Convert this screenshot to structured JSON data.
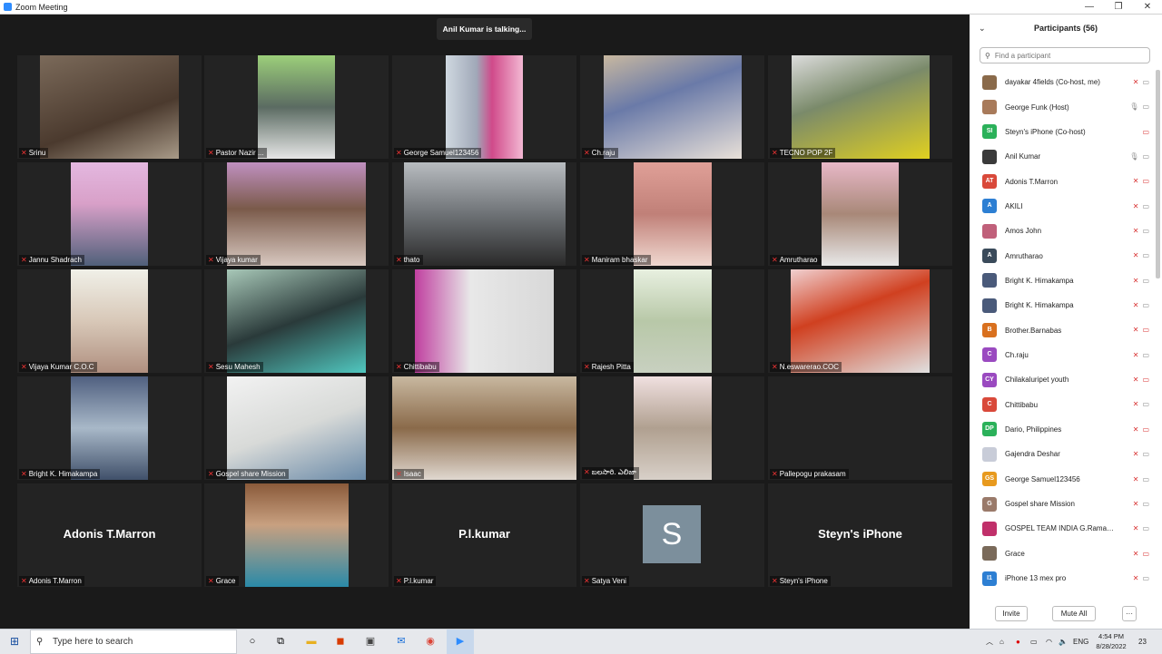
{
  "window": {
    "title": "Zoom Meeting",
    "controls": [
      "—",
      "❐",
      "✕"
    ]
  },
  "meeting": {
    "speaker_banner": "Anil Kumar is talking...",
    "tiles": [
      {
        "label": "Srinu",
        "video": "v1"
      },
      {
        "label": "Pastor Nazir ...",
        "video": "v2"
      },
      {
        "label": "George Samuel123456",
        "video": "v3"
      },
      {
        "label": "Ch.raju",
        "video": "v4"
      },
      {
        "label": "TECNO POP 2F",
        "video": "v5"
      },
      {
        "label": "Jannu Shadrach",
        "video": "v6"
      },
      {
        "label": "Vijaya kumar",
        "video": "v7"
      },
      {
        "label": "thato",
        "video": "v8"
      },
      {
        "label": "Maniram bhaskar",
        "video": "v9"
      },
      {
        "label": "Amrutharao",
        "video": "v10"
      },
      {
        "label": "Vijaya Kumar C.O.C",
        "video": "v11"
      },
      {
        "label": "Sesu Mahesh",
        "video": "v12"
      },
      {
        "label": "Chittibabu",
        "video": "v13"
      },
      {
        "label": "Rajesh Pitta",
        "video": "v14"
      },
      {
        "label": "N.eswarerao.COC",
        "video": "v15"
      },
      {
        "label": "Bright K. Himakampa",
        "video": "v16"
      },
      {
        "label": "Gospel share Mission",
        "video": "v17"
      },
      {
        "label": "Isaac",
        "video": "v18"
      },
      {
        "label": "బలసారి. ఎలిజా",
        "video": "v19"
      },
      {
        "label": "Pallepogu prakasam",
        "video": ""
      },
      {
        "label": "Adonis T.Marron",
        "big_name": "Adonis T.Marron"
      },
      {
        "label": "Grace",
        "video": "v20"
      },
      {
        "label": "P.l.kumar",
        "big_name": "P.l.kumar"
      },
      {
        "label": "Satya Veni",
        "avatar_letter": "S"
      },
      {
        "label": "Steyn's iPhone",
        "big_name": "Steyn's iPhone"
      }
    ]
  },
  "participants_panel": {
    "title": "Participants (56)",
    "search_placeholder": "Find a participant",
    "participants": [
      {
        "name": "dayakar 4fields (Co-host, me)",
        "initials": "",
        "color": "#8a6a4a",
        "mic": "muted",
        "cam": "on"
      },
      {
        "name": "George Funk (Host)",
        "initials": "",
        "color": "#a87a5a",
        "mic": "on",
        "cam": "on"
      },
      {
        "name": "Steyn's iPhone (Co-host)",
        "initials": "SI",
        "color": "#2bb15a",
        "mic": "none",
        "cam": "off"
      },
      {
        "name": "Anil Kumar",
        "initials": "",
        "color": "#3a3a3a",
        "mic": "on",
        "cam": "on"
      },
      {
        "name": "Adonis T.Marron",
        "initials": "AT",
        "color": "#d9493a",
        "mic": "muted",
        "cam": "off"
      },
      {
        "name": "AKILI",
        "initials": "A",
        "color": "#2d7fd3",
        "mic": "muted",
        "cam": "on"
      },
      {
        "name": "Amos John",
        "initials": "",
        "color": "#c0607a",
        "mic": "muted",
        "cam": "on"
      },
      {
        "name": "Amrutharao",
        "initials": "A",
        "color": "#3a4a5a",
        "mic": "muted",
        "cam": "on"
      },
      {
        "name": "Bright K. Himakampa",
        "initials": "",
        "color": "#4a5a7a",
        "mic": "muted",
        "cam": "on"
      },
      {
        "name": "Bright K. Himakampa",
        "initials": "",
        "color": "#4a5a7a",
        "mic": "muted",
        "cam": "on"
      },
      {
        "name": "Brother.Barnabas",
        "initials": "B",
        "color": "#d9701e",
        "mic": "muted",
        "cam": "off"
      },
      {
        "name": "Ch.raju",
        "initials": "C",
        "color": "#9a4ac0",
        "mic": "muted",
        "cam": "on"
      },
      {
        "name": "Chilakaluripet youth",
        "initials": "CY",
        "color": "#9a4ac0",
        "mic": "muted",
        "cam": "off"
      },
      {
        "name": "Chittibabu",
        "initials": "C",
        "color": "#d9493a",
        "mic": "muted",
        "cam": "on"
      },
      {
        "name": "Dario, Philippines",
        "initials": "DP",
        "color": "#2bb15a",
        "mic": "muted",
        "cam": "off"
      },
      {
        "name": "Gajendra Deshar",
        "initials": "",
        "color": "#c8ccd8",
        "mic": "muted",
        "cam": "on"
      },
      {
        "name": "George Samuel123456",
        "initials": "GS",
        "color": "#e89a1e",
        "mic": "muted",
        "cam": "on"
      },
      {
        "name": "Gospel share Mission",
        "initials": "G",
        "color": "#9a7a6a",
        "mic": "muted",
        "cam": "on"
      },
      {
        "name": "GOSPEL TEAM INDIA G.Ramac...",
        "initials": "",
        "color": "#c0306a",
        "mic": "muted",
        "cam": "on"
      },
      {
        "name": "Grace",
        "initials": "",
        "color": "#7a6a5a",
        "mic": "muted",
        "cam": "off"
      },
      {
        "name": "iPhone 13 mex pro",
        "initials": "I1",
        "color": "#2d7fd3",
        "mic": "muted",
        "cam": "on"
      }
    ],
    "invite_label": "Invite",
    "mute_all_label": "Mute All",
    "more_label": "···"
  },
  "taskbar": {
    "search_placeholder": "Type here to search",
    "language": "ENG",
    "time": "4:54 PM",
    "date": "8/28/2022",
    "notifications": "23"
  }
}
